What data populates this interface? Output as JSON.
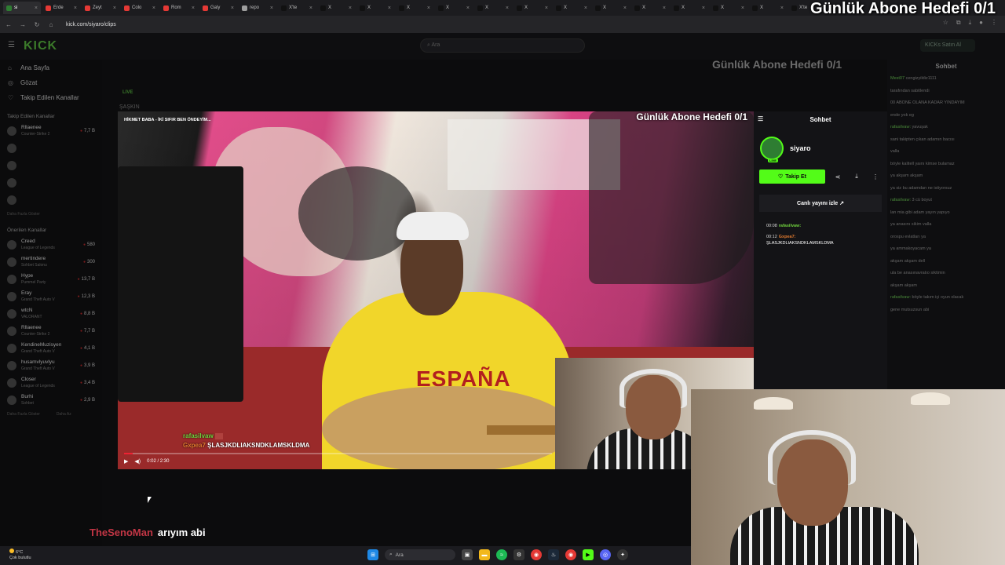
{
  "browser": {
    "tabs": [
      {
        "label": "si",
        "color": "#2e7d32",
        "active": true
      },
      {
        "label": "Erde",
        "color": "#e53935"
      },
      {
        "label": "Zeyt",
        "color": "#e53935"
      },
      {
        "label": "Colo",
        "color": "#e53935"
      },
      {
        "label": "Rom",
        "color": "#e53935"
      },
      {
        "label": "Galy",
        "color": "#e53935"
      },
      {
        "label": "repo",
        "color": "#9e9e9e"
      },
      {
        "label": "X'te",
        "color": "#111"
      },
      {
        "label": "X",
        "color": "#111"
      },
      {
        "label": "X",
        "color": "#111"
      },
      {
        "label": "X",
        "color": "#111"
      },
      {
        "label": "X",
        "color": "#111"
      },
      {
        "label": "X",
        "color": "#111"
      },
      {
        "label": "X",
        "color": "#111"
      },
      {
        "label": "X",
        "color": "#111"
      },
      {
        "label": "X",
        "color": "#111"
      },
      {
        "label": "X",
        "color": "#111"
      },
      {
        "label": "X",
        "color": "#111"
      },
      {
        "label": "X",
        "color": "#111"
      },
      {
        "label": "X",
        "color": "#111"
      },
      {
        "label": "X'te",
        "color": "#111"
      }
    ],
    "url": "kick.com/siyaro/clips"
  },
  "overlay": {
    "goal_text": "Günlük Abone Hedefi 0/1"
  },
  "kick": {
    "logo": "KICK",
    "search_placeholder": "Ara",
    "buy_button": "KICKs Satın Al",
    "nav": [
      {
        "label": "Ana Sayfa",
        "icon": "home-icon"
      },
      {
        "label": "Gözat",
        "icon": "compass-icon"
      },
      {
        "label": "Takip Edilen Kanallar",
        "icon": "heart-icon"
      }
    ],
    "followed_header": "Takip Edilen Kanallar",
    "followed": [
      {
        "name": "Rllaenee",
        "game": "Counter-Strike 2",
        "viewers": "7,7 B"
      }
    ],
    "show_more": "Daha Fazla Göster",
    "recommended_header": "Önerilen Kanallar",
    "recommended": [
      {
        "name": "Creed",
        "game": "League of Legends",
        "viewers": "580"
      },
      {
        "name": "mertindere",
        "game": "Sohbet Salonu",
        "viewers": "300"
      },
      {
        "name": "Hype",
        "game": "Pummel Party",
        "viewers": "13,7 B"
      },
      {
        "name": "Eray",
        "game": "Grand Theft Auto V",
        "viewers": "12,3 B"
      },
      {
        "name": "wtcN",
        "game": "VALORANT",
        "viewers": "8,8 B"
      },
      {
        "name": "Rllaenee",
        "game": "Counter-Strike 2",
        "viewers": "7,7 B"
      },
      {
        "name": "KendineMuzisyen",
        "game": "Grand Theft Auto V",
        "viewers": "4,1 B"
      },
      {
        "name": "husamvlyuvlyu",
        "game": "Grand Theft Auto V",
        "viewers": "3,9 B"
      },
      {
        "name": "Closer",
        "game": "League of Legends",
        "viewers": "3,4 B"
      },
      {
        "name": "Burhi",
        "game": "Sohbet",
        "viewers": "2,9 B"
      }
    ],
    "show_more_2": "Daha Fazla Göster",
    "show_less": "Daha Az",
    "live_tag": "LIVE",
    "streamer_title": "ŞAŞKIN",
    "chat_title": "Sohbet",
    "chat_lines": [
      {
        "user": "Mest07",
        "msg": "cengizyildiz1111"
      },
      {
        "user": "",
        "msg": "tarafından sabitlendi"
      },
      {
        "user": "",
        "msg": "00 ABONE OLANA KADAR YINDAYIM"
      },
      {
        "user": "",
        "msg": "ende yok eg"
      },
      {
        "user": "rafasilvaw:",
        "msg": "yavuşak"
      },
      {
        "user": "",
        "msg": "sani takipten çıkan adamın bacısı"
      },
      {
        "user": "",
        "msg": "valla"
      },
      {
        "user": "",
        "msg": "böyle kalitell yaını kimse bulamaz"
      },
      {
        "user": "",
        "msg": "ya akşam akşam"
      },
      {
        "user": "",
        "msg": "ya siz bu adamdan ne istiyorsuz"
      },
      {
        "user": "rafasilvaw:",
        "msg": "3 cü boyut"
      },
      {
        "user": "",
        "msg": "lan mia gibi adam yayın yapıyo"
      },
      {
        "user": "",
        "msg": "ya anasını sikim valla"
      },
      {
        "user": "",
        "msg": "orospu evlatları ya"
      },
      {
        "user": "",
        "msg": "ya ammakoyacam ya"
      },
      {
        "user": "",
        "msg": "akşam akşam dell"
      },
      {
        "user": "",
        "msg": "ula be anasınavratıo siktimin"
      },
      {
        "user": "",
        "msg": "akşam akşam"
      },
      {
        "user": "rafasilvaw:",
        "msg": "böyle takım içi oyun olacak"
      },
      {
        "user": "",
        "msg": "gene mutsuzsun abi"
      }
    ]
  },
  "clip": {
    "title": "HİKMET BABA - İKİ SIFIR BEN ÖNDEYİM...",
    "shirt_text": "ESPAÑA",
    "chat_user1": "rafasilvaw",
    "chat_user2": "Gxpea7",
    "chat_msg": "ŞLASJKDLIAKSNDKLAMSKLDMA",
    "time": "0:02 / 2:30",
    "progress": 0.02
  },
  "side_panel": {
    "title": "Sohbet",
    "username": "siyaro",
    "live_badge": "LIVE",
    "follow_label": "Takip Et",
    "watch_live": "Canlı yayını izle",
    "chat": [
      {
        "time": "00:08",
        "user": "rafasilvaw:",
        "msg": ""
      },
      {
        "time": "00:12",
        "user": "Gxpea7:",
        "msg": "ŞLASJKDLIAKSNDKLAMSKLDMA"
      }
    ]
  },
  "caption": {
    "user": "TheSenoMan",
    "message": "arıyım abi"
  },
  "taskbar": {
    "temp": "6°C",
    "weather": "Çok bulutlu",
    "search": "Ara"
  }
}
